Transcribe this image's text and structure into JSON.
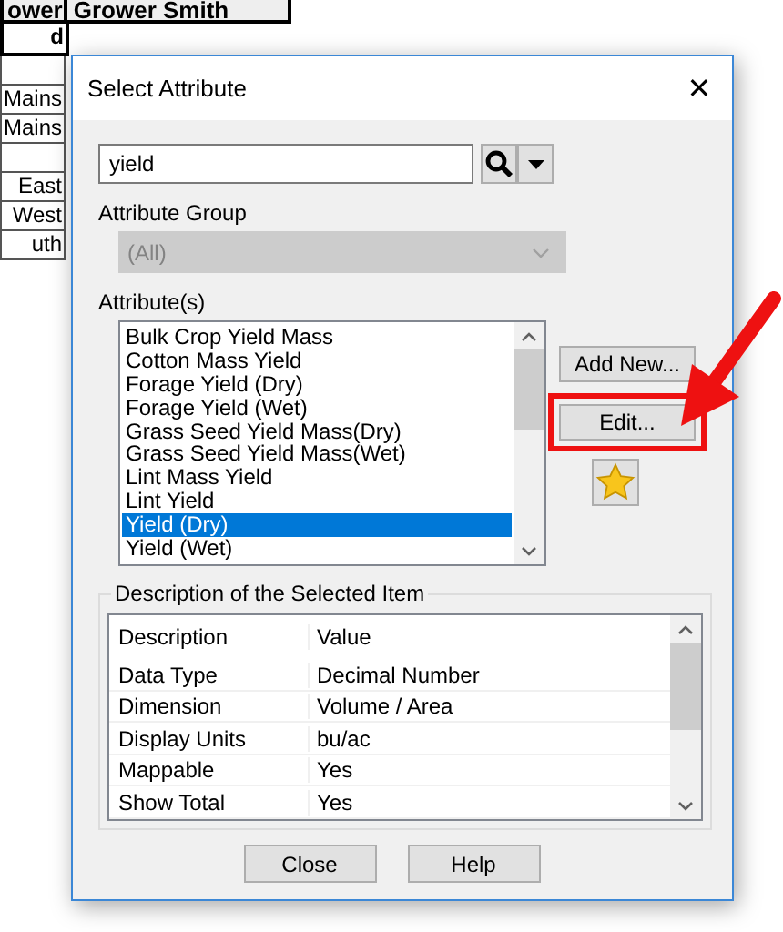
{
  "sheet": {
    "header": [
      "ower",
      "Grower Smith"
    ],
    "rows": [
      {
        "text": "d",
        "bold": true
      },
      {
        "bold": false
      },
      {
        "text": "Mains",
        "bold": false
      },
      {
        "text": "Mains",
        "bold": false
      },
      {
        "bold": false
      },
      {
        "text": "East",
        "bold": false
      },
      {
        "text": "West",
        "bold": false
      },
      {
        "text": "uth",
        "bold": false
      }
    ]
  },
  "dialog": {
    "title": "Select Attribute",
    "close_glyph": "✕",
    "search": {
      "value": "yield"
    },
    "attribute_group": {
      "label": "Attribute Group",
      "value": "(All)",
      "disabled": true
    },
    "attributes": {
      "label": "Attribute(s)",
      "items": [
        {
          "label": "Bulk Crop Yield Mass",
          "selected": false
        },
        {
          "label": "Cotton Mass Yield",
          "selected": false
        },
        {
          "label": "Forage Yield (Dry)",
          "selected": false
        },
        {
          "label": "Forage Yield (Wet)",
          "selected": false
        },
        {
          "label": "Grass Seed Yield Mass(Dry)",
          "selected": false
        },
        {
          "label": "Grass Seed Yield Mass(Wet)",
          "selected": false
        },
        {
          "label": "Lint Mass Yield",
          "selected": false
        },
        {
          "label": "Lint Yield",
          "selected": false
        },
        {
          "label": "Yield (Dry)",
          "selected": true
        },
        {
          "label": "Yield (Wet)",
          "selected": false
        }
      ]
    },
    "side_buttons": [
      {
        "label": "Add New...",
        "highlighted": false
      },
      {
        "label": "Edit...",
        "highlighted": true
      }
    ],
    "description": {
      "title": "Description of the Selected Item",
      "columns": [
        "Description",
        "Value"
      ],
      "rows": [
        [
          "Data Type",
          "Decimal Number"
        ],
        [
          "Dimension",
          "Volume / Area"
        ],
        [
          "Display Units",
          "bu/ac"
        ],
        [
          "Mappable",
          "Yes"
        ],
        [
          "Show Total",
          "Yes"
        ]
      ]
    },
    "buttons": [
      "Close",
      "Help"
    ]
  }
}
